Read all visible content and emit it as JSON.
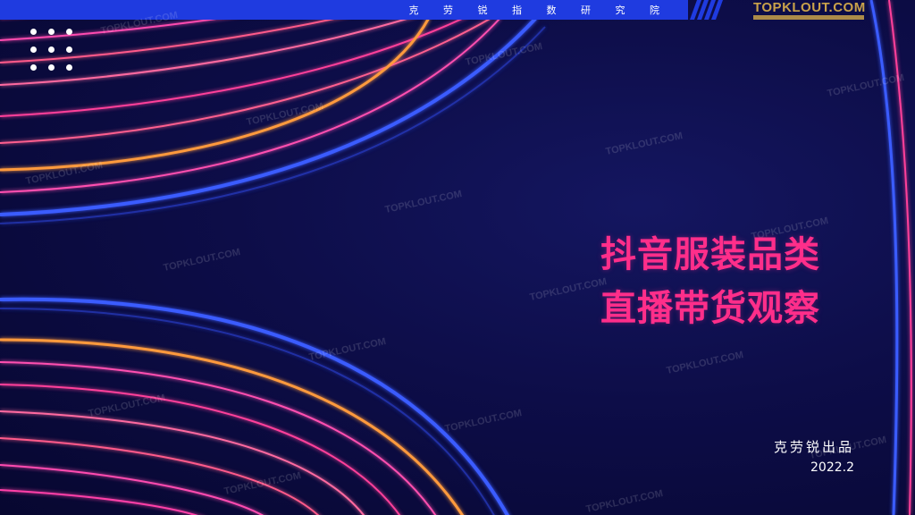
{
  "header": {
    "org_name": "克 劳 锐 指 数 研 究 院",
    "logo_text": "TOPKLOUT.COM"
  },
  "watermark": {
    "text": "TOPKLOUT.COM"
  },
  "main": {
    "title_line1": "抖音服装品类",
    "title_line2": "直播带货观察",
    "producer": "克劳锐出品",
    "date": "2022.2"
  },
  "colors": {
    "accent": "#ff2e8a",
    "bar": "#1f3be0",
    "logo_gold": "#c9a24a",
    "background": "#0d0d48"
  },
  "icons": [
    "dot-grid-icon",
    "stripes-decoration"
  ]
}
